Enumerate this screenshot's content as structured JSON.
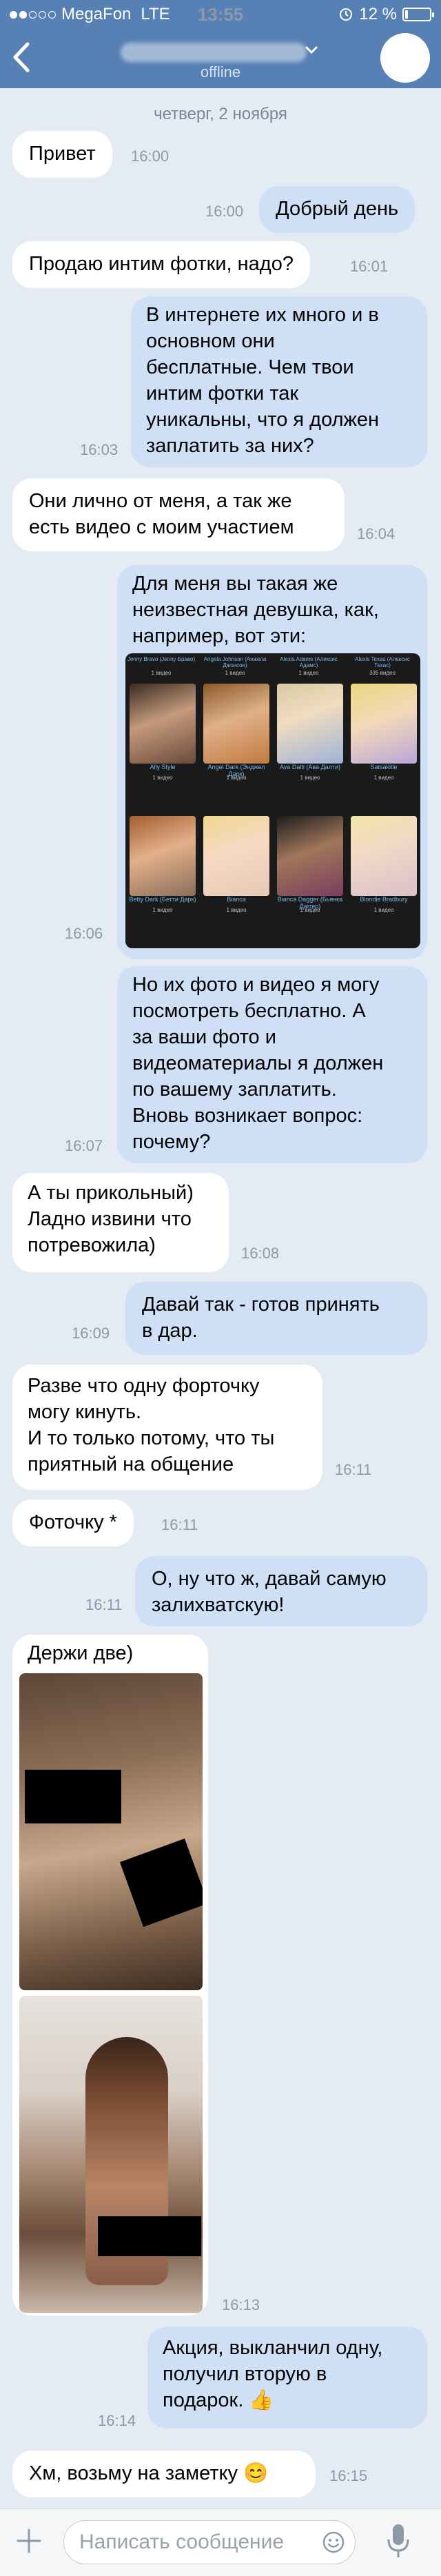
{
  "status": {
    "carrier": "MegaFon",
    "network": "LTE",
    "time": "13:55",
    "battery": "12 %",
    "battery_level": 0.12
  },
  "header": {
    "contact_status": "offline"
  },
  "date_separator": "четверг, 2 ноября",
  "messages": {
    "m1": {
      "text": "Привет",
      "time": "16:00"
    },
    "m2": {
      "text": "Добрый день",
      "time": "16:00"
    },
    "m3": {
      "text": "Продаю интим фотки, надо?",
      "time": "16:01"
    },
    "m4": {
      "lines": [
        "В интернете их много и в",
        "основном они",
        "бесплатные. Чем твои",
        "интим фотки так",
        "уникальны, что я должен",
        "заплатить за них?"
      ],
      "time": "16:03"
    },
    "m5": {
      "lines": [
        "Они лично от меня, а так же",
        "есть видео с моим участием"
      ],
      "time": "16:04"
    },
    "m6": {
      "lines": [
        "Для меня вы такая же",
        "неизвестная девушка, как,",
        "например, вот эти:"
      ],
      "time": "16:06",
      "grid_top": [
        "Jenny Bravo (Jenny Браво)",
        "Angela Johnson (Анжела Джонсон)",
        "Alexis Adams (Алексис Адамс)",
        "Alexis Texas (Алексис Техас)"
      ],
      "grid_top_sub": [
        "1 видео",
        "1 видео",
        "1 видео",
        "335 видео"
      ],
      "grid": [
        {
          "name": "Ally Style",
          "sub": "1 видео"
        },
        {
          "name": "Angel Dark (Энджел Дарк)",
          "sub": "1 видео"
        },
        {
          "name": "Ava Dalti (Ава Далти)",
          "sub": "1 видео"
        },
        {
          "name": "Satsakitle",
          "sub": "1 видео"
        },
        {
          "name": "Betty Dark (Бетти Дарк)",
          "sub": "1 видео"
        },
        {
          "name": "Bianca",
          "sub": "1 видео"
        },
        {
          "name": "Bianca Dagger (Бьянка Даггер)",
          "sub": "1 видео"
        },
        {
          "name": "Blondie Bradbury",
          "sub": "1 видео"
        }
      ]
    },
    "m7": {
      "lines": [
        "Но их фото и видео я могу",
        "посмотреть бесплатно. А",
        "за ваши фото и",
        "видеоматериалы я должен",
        "по вашему заплатить.",
        "Вновь возникает вопрос:",
        "почему?"
      ],
      "time": "16:07"
    },
    "m8": {
      "lines": [
        "А ты прикольный)",
        "Ладно извини что",
        "потревожила)"
      ],
      "time": "16:08"
    },
    "m9": {
      "lines": [
        "Давай так - готов принять",
        "в дар."
      ],
      "time": "16:09"
    },
    "m10": {
      "lines": [
        "Разве что одну форточку",
        "могу кинуть.",
        "И то только потому, что ты",
        "приятный на общение"
      ],
      "time": "16:11"
    },
    "m11": {
      "text": "Фоточку *",
      "time": "16:11"
    },
    "m12": {
      "lines": [
        "О, ну что ж, давай самую",
        "залихватскую!"
      ],
      "time": "16:11"
    },
    "m13": {
      "text": "Держи две)",
      "time": "16:13"
    },
    "m14": {
      "lines": [
        "Акция, выкланчил одну,",
        "получил вторую в",
        "подарок. 👍"
      ],
      "time": "16:14"
    },
    "m15": {
      "text": "Хм, возьму на заметку 😊",
      "time": "16:15"
    }
  },
  "input": {
    "placeholder": "Написать сообщение"
  },
  "colors": {
    "header": "#5780b5",
    "background": "#e4ebf3",
    "incoming": "#ffffff",
    "outgoing": "#cfe0f6"
  },
  "icons": [
    "back-chevron-icon",
    "dropdown-chevron-icon",
    "attach-plus-icon",
    "emoji-icon",
    "microphone-icon"
  ]
}
